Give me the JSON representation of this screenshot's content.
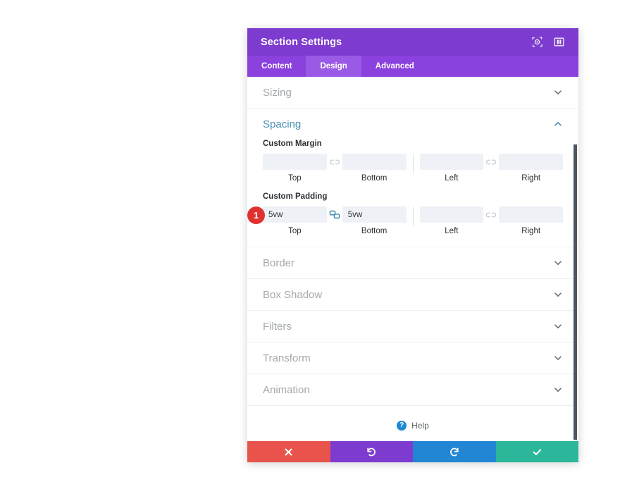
{
  "panel": {
    "title": "Section Settings",
    "titlebar_icons": [
      {
        "name": "focus-target-icon",
        "glyph": "target"
      },
      {
        "name": "layout-columns-icon",
        "glyph": "columns"
      }
    ],
    "tabs": [
      {
        "label": "Content",
        "active": false
      },
      {
        "label": "Design",
        "active": true
      },
      {
        "label": "Advanced",
        "active": false
      }
    ]
  },
  "sections": [
    {
      "id": "sizing",
      "title": "Sizing",
      "open": false,
      "chevron": "chevron-down"
    },
    {
      "id": "spacing",
      "title": "Spacing",
      "open": true,
      "chevron": "chevron-up"
    },
    {
      "id": "border",
      "title": "Border",
      "open": false,
      "chevron": "chevron-down"
    },
    {
      "id": "box-shadow",
      "title": "Box Shadow",
      "open": false,
      "chevron": "chevron-down"
    },
    {
      "id": "filters",
      "title": "Filters",
      "open": false,
      "chevron": "chevron-down"
    },
    {
      "id": "transform",
      "title": "Transform",
      "open": false,
      "chevron": "chevron-down"
    },
    {
      "id": "animation",
      "title": "Animation",
      "open": false,
      "chevron": "chevron-down"
    }
  ],
  "spacing": {
    "margin": {
      "label": "Custom Margin",
      "top": {
        "value": "",
        "caption": "Top"
      },
      "bottom": {
        "value": "",
        "caption": "Bottom"
      },
      "left": {
        "value": "",
        "caption": "Left"
      },
      "right": {
        "value": "",
        "caption": "Right"
      },
      "link_tb": {
        "state": "unlinked",
        "icon": "link-broken-icon"
      },
      "link_lr": {
        "state": "unlinked",
        "icon": "link-broken-icon"
      }
    },
    "padding": {
      "label": "Custom Padding",
      "top": {
        "value": "5vw",
        "caption": "Top"
      },
      "bottom": {
        "value": "5vw",
        "caption": "Bottom"
      },
      "left": {
        "value": "",
        "caption": "Left"
      },
      "right": {
        "value": "",
        "caption": "Right"
      },
      "link_tb": {
        "state": "linked",
        "icon": "link-connected-icon"
      },
      "link_lr": {
        "state": "unlinked",
        "icon": "link-broken-icon"
      }
    },
    "step_badge": "1"
  },
  "help": {
    "label": "Help",
    "icon": "question-mark-icon"
  },
  "footer": [
    {
      "name": "discard-button",
      "icon": "close-x-icon",
      "color": "#e8544b"
    },
    {
      "name": "undo-button",
      "icon": "undo-arrow-icon",
      "color": "#7e3bd0"
    },
    {
      "name": "redo-button",
      "icon": "redo-arrow-icon",
      "color": "#2286d4"
    },
    {
      "name": "save-button",
      "icon": "checkmark-icon",
      "color": "#2cb79a"
    }
  ],
  "colors": {
    "titlebar": "#7e3bd0",
    "tabbar": "#8a41dd",
    "tab_active": "#9b5ae6",
    "section_open_title": "#4a8fb5",
    "input_bg": "#eef1f6",
    "link_active": "#2f7fa8",
    "badge": "#e03131"
  }
}
